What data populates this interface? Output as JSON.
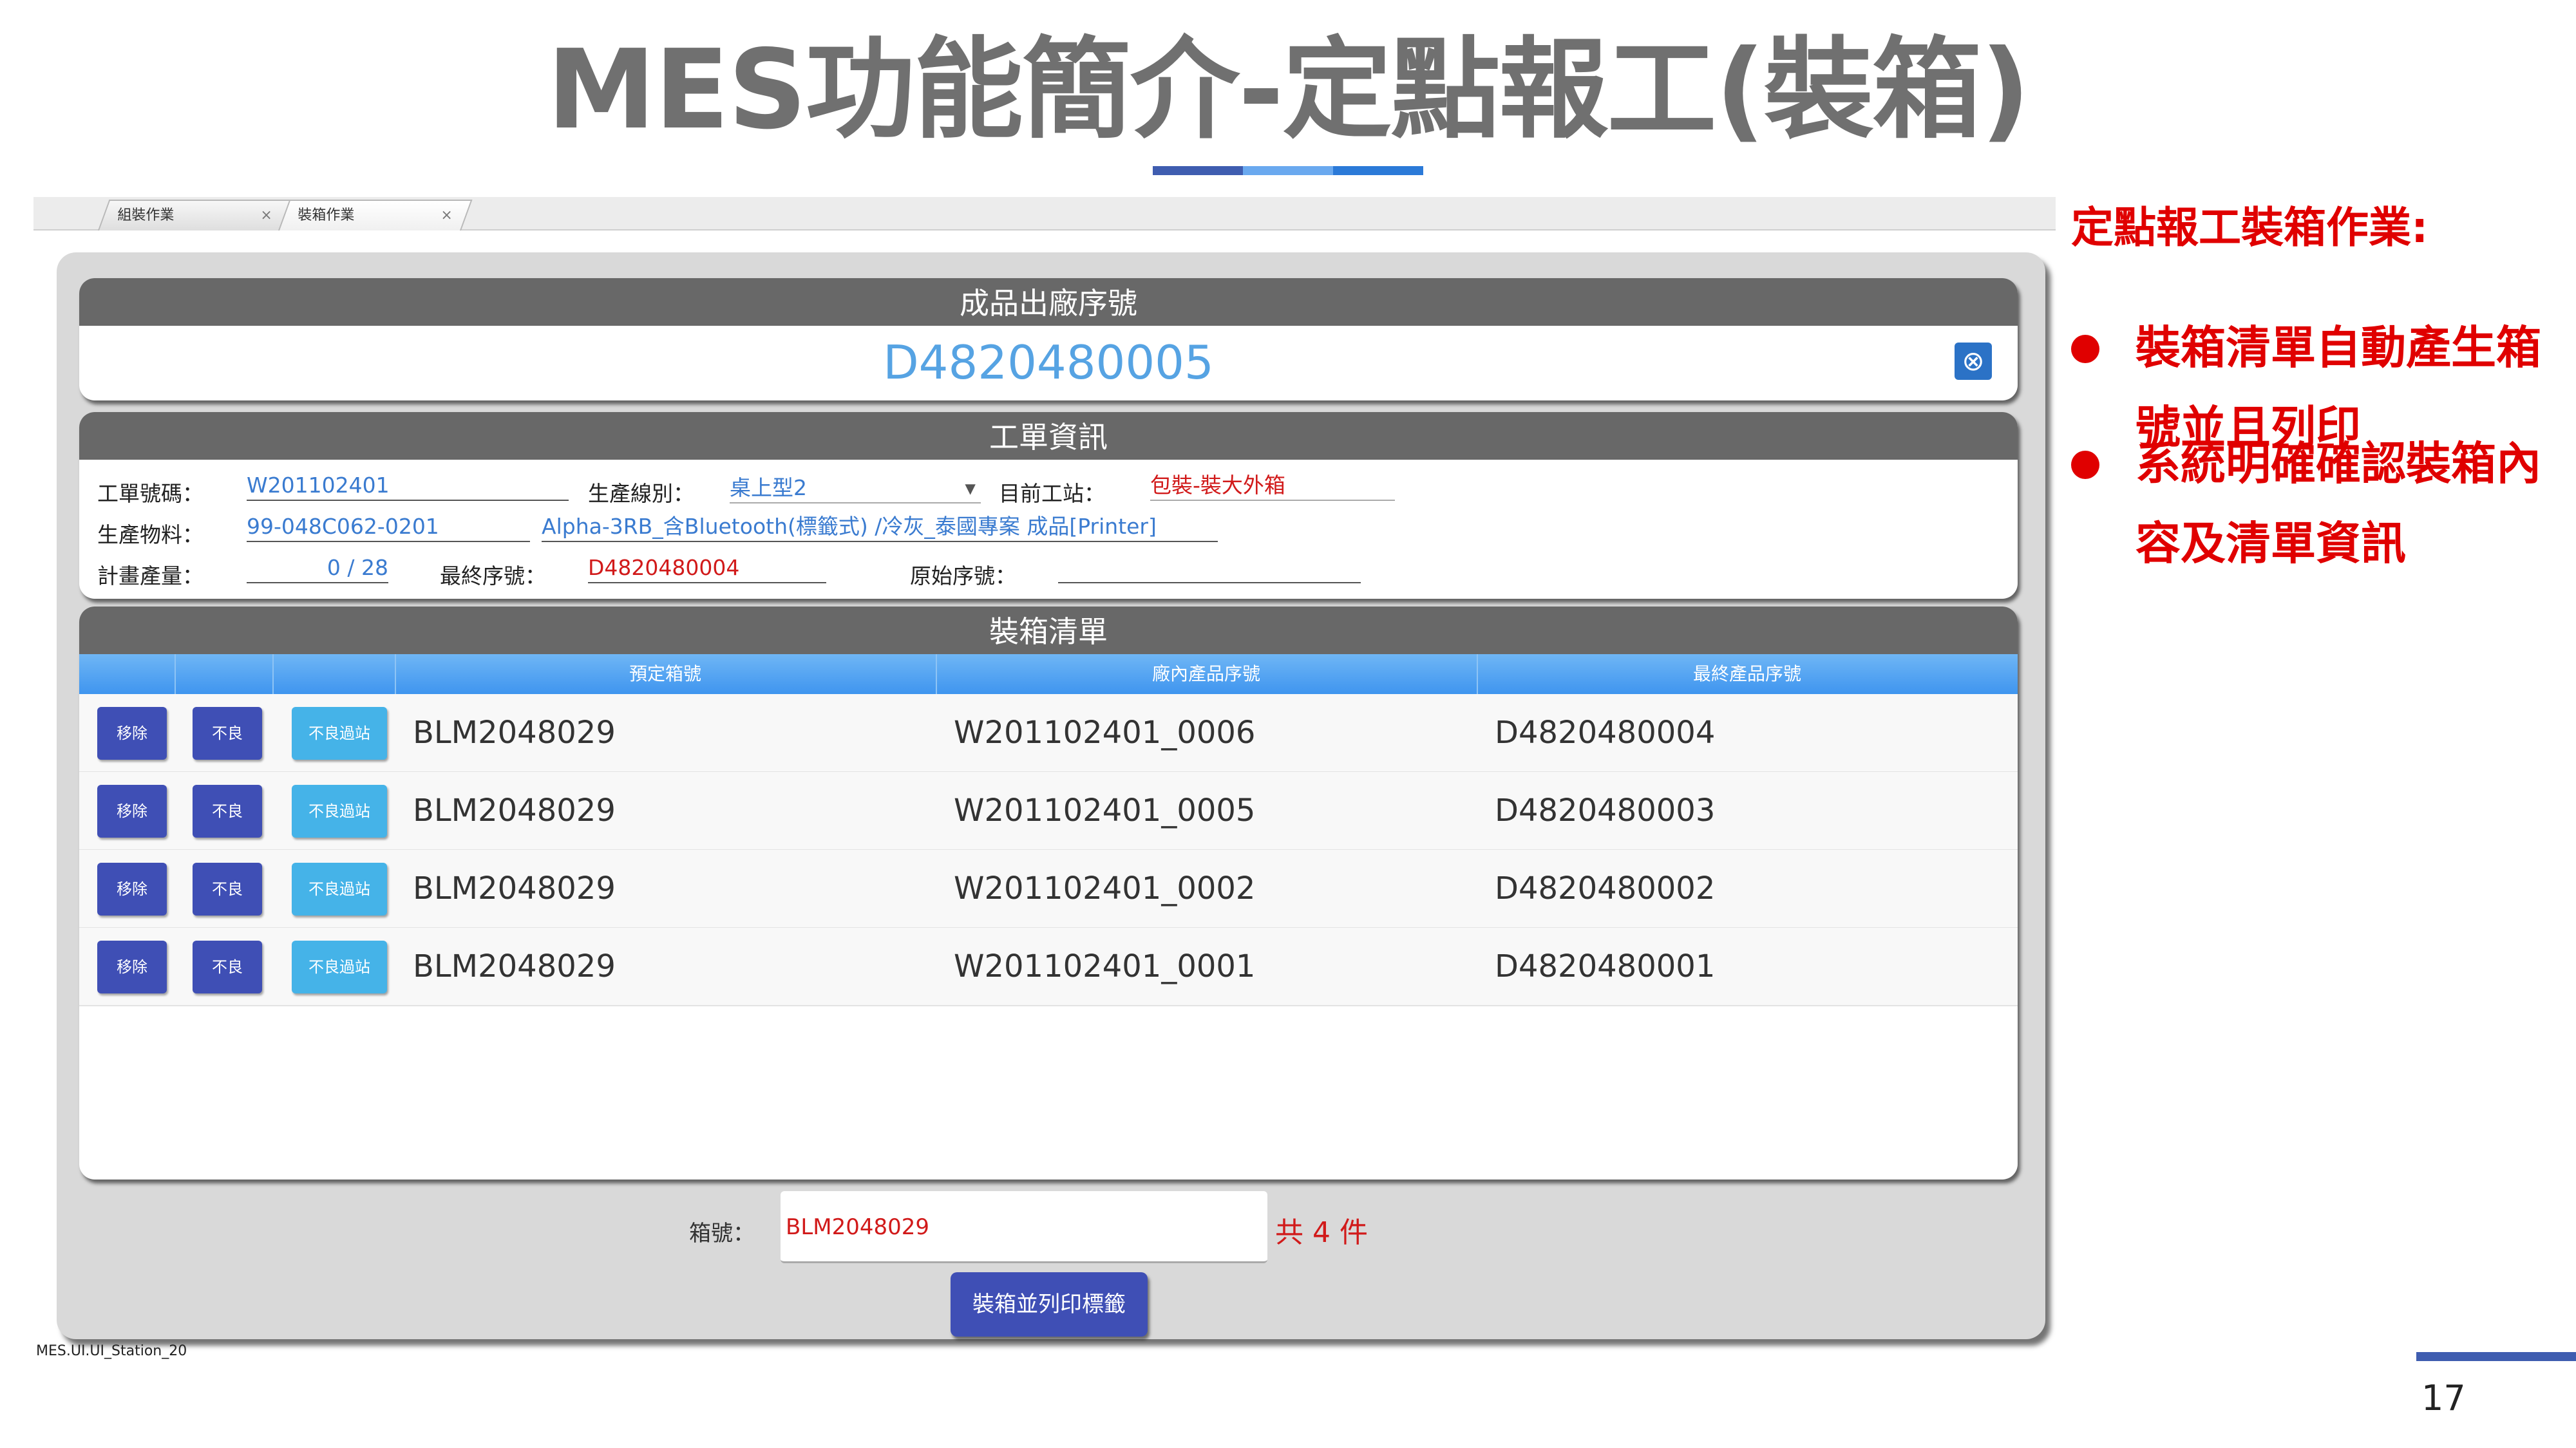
{
  "slide": {
    "title": "MES功能簡介-定點報工(裝箱)",
    "underline_colors": [
      "#3f5db0",
      "#6aa9ef",
      "#2b7ad8"
    ],
    "page_number": "17"
  },
  "tabs": [
    {
      "label": "組裝作業",
      "close": "×"
    },
    {
      "label": "裝箱作業",
      "close": "×"
    }
  ],
  "serial_section": {
    "header": "成品出廠序號",
    "value": "D4820480005",
    "clear_icon": "⊗"
  },
  "work_order": {
    "header": "工單資訊",
    "order_no_label": "工單號碼：",
    "order_no": "W201102401",
    "line_label": "生產線別：",
    "line_value": "桌上型2",
    "line_arrow": "▾",
    "station_label": "目前工站：",
    "station_value": "包裝-裝大外箱",
    "material_label": "生產物料：",
    "material_code": "99-048C062-0201",
    "material_desc": "Alpha-3RB_含Bluetooth(標籤式) /冷灰_泰國專案 成品[Printer]",
    "qty_label": "計畫產量：",
    "qty_value": "0 / 28",
    "final_serial_label": "最終序號：",
    "final_serial_value": "D4820480004",
    "original_serial_label": "原始序號：",
    "original_serial_value": ""
  },
  "packing_list": {
    "header": "裝箱清單",
    "columns": [
      "預定箱號",
      "廠內產品序號",
      "最終產品序號"
    ],
    "button_labels": {
      "remove": "移除",
      "ng": "不良",
      "ng_pass": "不良過站"
    },
    "rows": [
      {
        "box": "BLM2048029",
        "internal": "W201102401_0006",
        "final": "D4820480004"
      },
      {
        "box": "BLM2048029",
        "internal": "W201102401_0005",
        "final": "D4820480003"
      },
      {
        "box": "BLM2048029",
        "internal": "W201102401_0002",
        "final": "D4820480002"
      },
      {
        "box": "BLM2048029",
        "internal": "W201102401_0001",
        "final": "D4820480001"
      }
    ]
  },
  "box": {
    "label": "箱號：",
    "value": "BLM2048029",
    "count_text": "共 4 件",
    "print_button": "裝箱並列印標籤"
  },
  "app_footer": "MES.UI.UI_Station_20",
  "notes": {
    "title": "定點報工裝箱作業:",
    "items": [
      "裝箱清單自動產生箱號並且列印",
      "系統明確確認裝箱內容及清單資訊"
    ]
  },
  "colors": {
    "accent_red": "#e00000",
    "grid_blue": "#3f95ef",
    "button_navy": "#3f4fb5",
    "button_cyan": "#45b3e8"
  }
}
